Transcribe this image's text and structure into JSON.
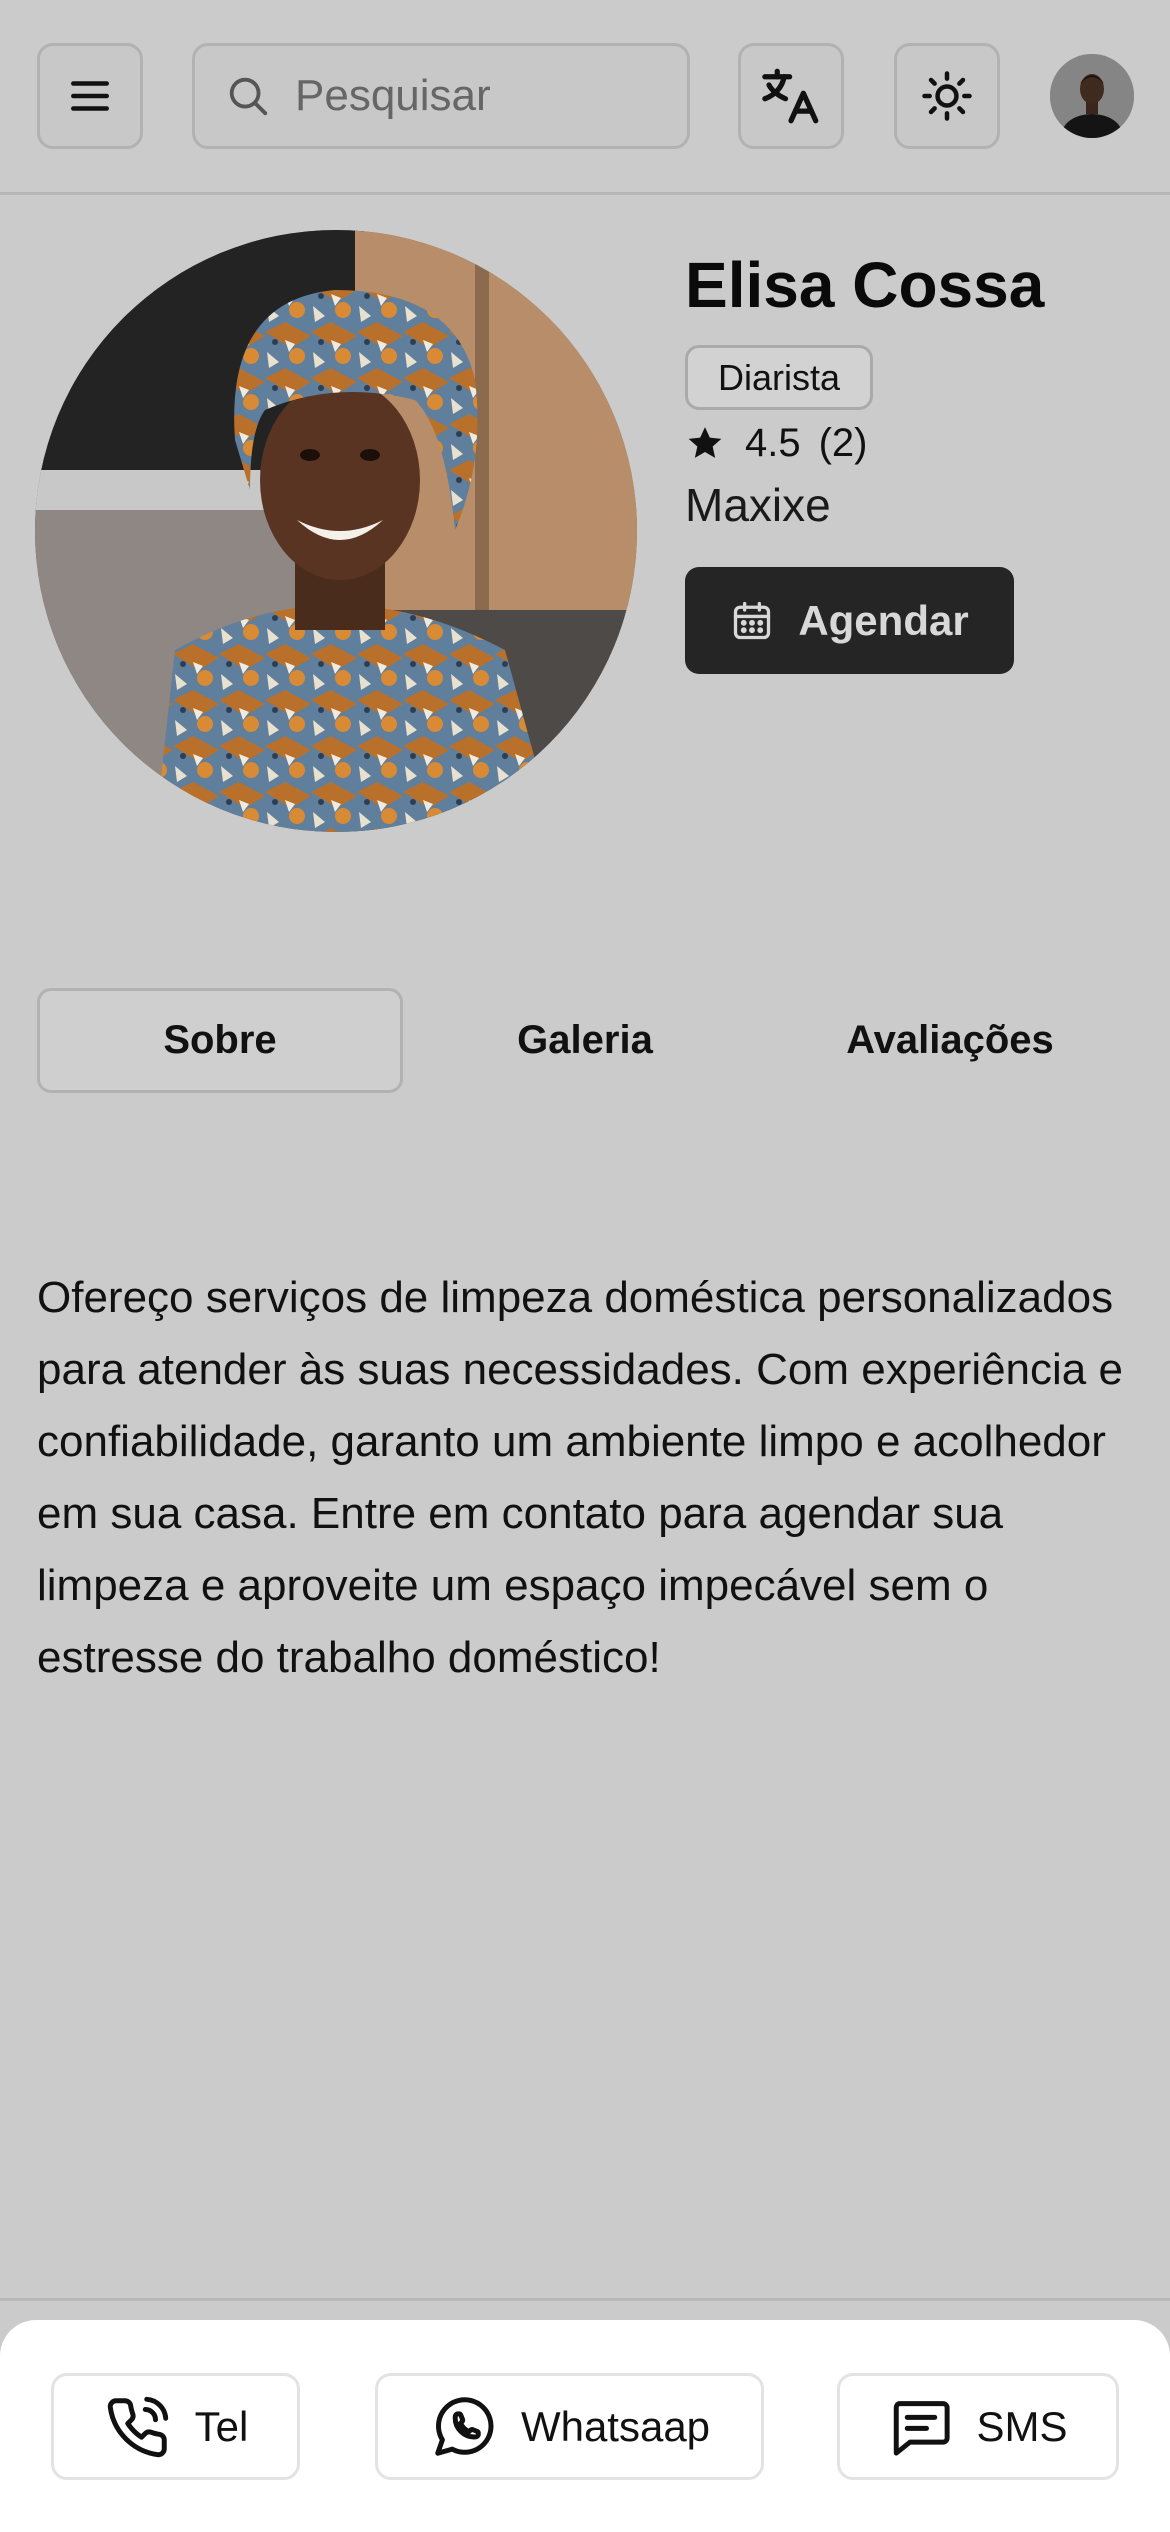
{
  "header": {
    "menu_icon": "hamburger-menu-icon",
    "search": {
      "placeholder": "Pesquisar",
      "icon": "search-icon"
    },
    "translate_icon": "translate-icon",
    "theme_icon": "sun-icon",
    "user_avatar_icon": "user-avatar"
  },
  "profile": {
    "name": "Elisa Cossa",
    "category": "Diarista",
    "rating": "4.5",
    "rating_count": "(2)",
    "location": "Maxixe",
    "book_button_label": "Agendar",
    "book_button_icon": "calendar-icon"
  },
  "tabs": [
    {
      "label": "Sobre",
      "active": true
    },
    {
      "label": "Galeria",
      "active": false
    },
    {
      "label": "Avaliações",
      "active": false
    }
  ],
  "about_text": "Ofereço serviços de limpeza doméstica personalizados para atender às suas necessidades. Com experiência e confiabilidade, garanto um ambiente limpo e acolhedor em sua casa. Entre em contato para agendar sua limpeza e aproveite um espaço impecável sem o estresse do trabalho doméstico!",
  "contact": {
    "tel_label": "Tel",
    "whatsapp_label": "Whatsaap",
    "sms_label": "SMS"
  },
  "colors": {
    "background": "#cbcbcb",
    "primary_button": "#252525",
    "bottom_bar": "#ffffff"
  }
}
